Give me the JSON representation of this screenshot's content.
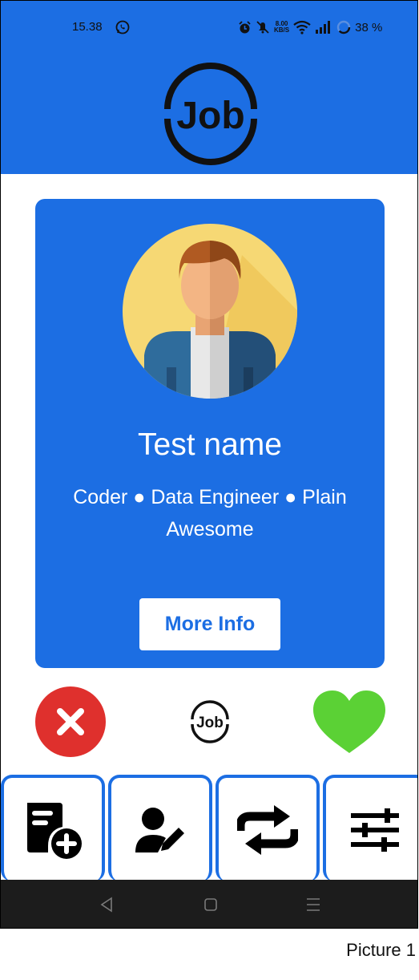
{
  "status_bar": {
    "time": "15.38",
    "net_speed_value": "8.00",
    "net_speed_unit": "KB/S",
    "battery": "38 %",
    "icons": [
      "whatsapp-icon",
      "alarm-icon",
      "mute-icon",
      "wifi-icon",
      "signal-icon",
      "battery-ring-icon"
    ]
  },
  "header": {
    "logo_text": "Job"
  },
  "profile": {
    "name": "Test name",
    "tagline": "Coder ● Data Engineer ● Plain Awesome",
    "more_info_label": "More Info"
  },
  "actions": {
    "reject_icon": "close-icon",
    "center_logo_text": "Job",
    "like_icon": "heart-icon"
  },
  "toolbar": {
    "items": [
      {
        "icon": "add-note-icon"
      },
      {
        "icon": "edit-user-icon"
      },
      {
        "icon": "swap-icon"
      },
      {
        "icon": "sliders-icon"
      }
    ]
  },
  "nav": {
    "keys": [
      "back-icon",
      "home-icon",
      "menu-icon"
    ]
  },
  "caption": "Picture 1",
  "colors": {
    "primary": "#1c6ee3",
    "reject": "#df302d",
    "like": "#5bd135",
    "nav_bar": "#1c1c1c"
  }
}
